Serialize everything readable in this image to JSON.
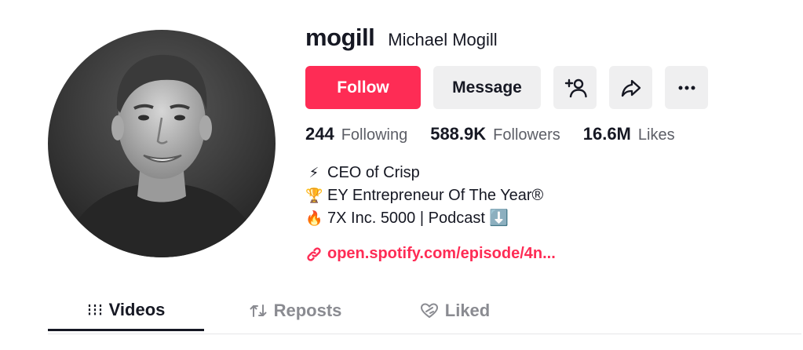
{
  "profile": {
    "username": "mogill",
    "display_name": "Michael Mogill"
  },
  "actions": {
    "follow_label": "Follow",
    "message_label": "Message",
    "icons": [
      "add-friend-icon",
      "share-icon",
      "more-icon"
    ]
  },
  "stats": [
    {
      "value": "244",
      "label": "Following"
    },
    {
      "value": "588.9K",
      "label": "Followers"
    },
    {
      "value": "16.6M",
      "label": "Likes"
    }
  ],
  "bio": [
    {
      "emoji": "⚡",
      "text": "CEO of Crisp"
    },
    {
      "emoji": "🏆",
      "text": "EY Entrepreneur Of The Year®"
    },
    {
      "emoji": "🔥",
      "text": "7X Inc. 5000 | Podcast ⬇️"
    }
  ],
  "link": {
    "text": "open.spotify.com/episode/4n..."
  },
  "tabs": [
    {
      "label": "Videos",
      "icon": "grid-icon",
      "active": true
    },
    {
      "label": "Reposts",
      "icon": "repost-icon",
      "active": false
    },
    {
      "label": "Liked",
      "icon": "liked-heart-icon",
      "active": false
    }
  ],
  "colors": {
    "accent": "#fe2c55",
    "button_gray": "#efeff0",
    "text_primary": "#161823",
    "text_secondary": "#5c5e66"
  }
}
